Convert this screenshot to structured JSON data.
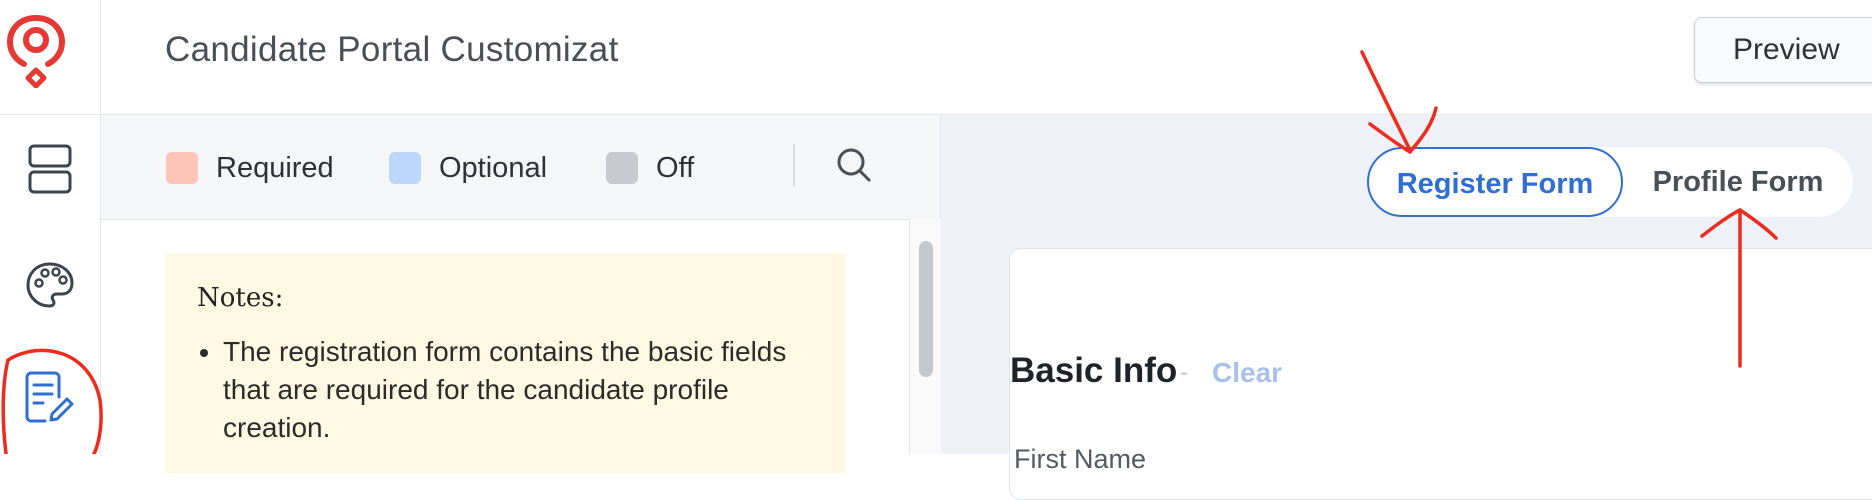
{
  "header": {
    "title": "Candidate Portal Customizat",
    "preview_label": "Preview"
  },
  "sidebar": {
    "items": [
      {
        "icon": "layout-icon",
        "active": false
      },
      {
        "icon": "palette-icon",
        "active": false
      },
      {
        "icon": "form-edit-icon",
        "active": true
      }
    ]
  },
  "legend": {
    "required": {
      "label": "Required",
      "color": "#ffc4b8"
    },
    "optional": {
      "label": "Optional",
      "color": "#bcd7fb"
    },
    "off": {
      "label": "Off",
      "color": "#c7cad0"
    }
  },
  "notes": {
    "title": "Notes:",
    "items": [
      "The registration form contains the basic fields that are required for the candidate profile creation."
    ]
  },
  "form_toggle": {
    "register_label": "Register Form",
    "profile_label": "Profile Form",
    "selected": "Register Form"
  },
  "form": {
    "section_title": "Basic Info",
    "separator": "-",
    "clear_label": "Clear",
    "first_field_label": "First Name"
  },
  "colors": {
    "brand": "#e53935",
    "accent": "#2f6fd1",
    "annotation": "#ee2b1d"
  }
}
